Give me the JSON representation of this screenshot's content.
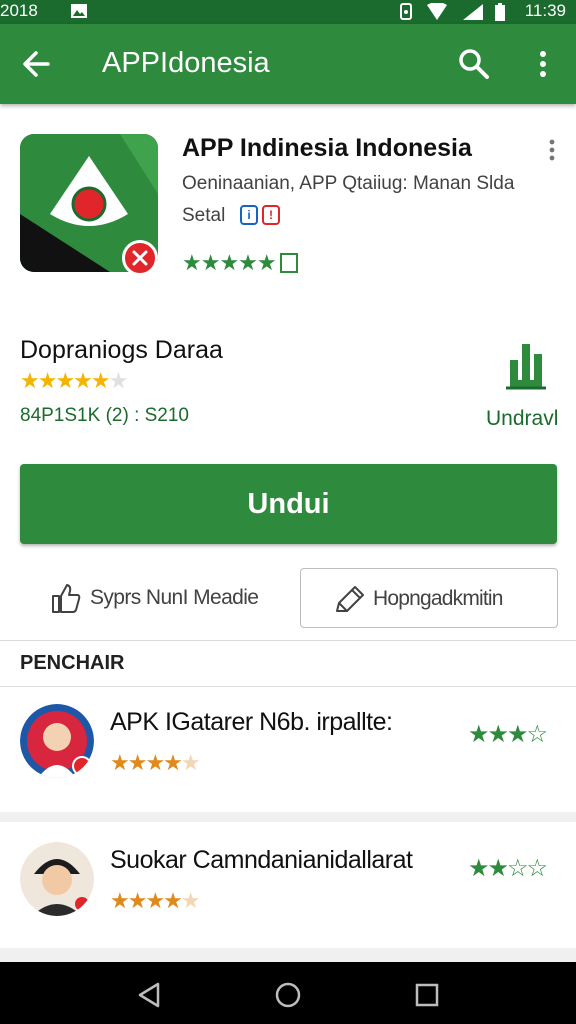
{
  "status_bar": {
    "time_left": "2018",
    "time_right": "11:39"
  },
  "app_bar": {
    "title": "APPIdonesia",
    "icons": [
      "back-arrow-icon",
      "search-icon",
      "more-vert-icon"
    ]
  },
  "app": {
    "name": "APP Indinesia Indonesia",
    "developer": "Oeninaanian, APP Qtaiiug: Manan Slda",
    "category": "Setal",
    "category_badges": [
      "info",
      "warning"
    ],
    "rating_stars": "★★★★★",
    "colors": {
      "accent": "#2e8b3e",
      "badge": "#e0262b"
    }
  },
  "download": {
    "title": "Dopraniogs Daraa",
    "stars_filled": "★★★★★",
    "stars_empty": "★",
    "meta": "84P1S1K (2) : S210",
    "link_label": "Undravl"
  },
  "main_button": {
    "label": "Undui"
  },
  "actions": {
    "like_label": "Syprs NunI Meadie",
    "edit_label": "Hopngadkmitin"
  },
  "section": {
    "heading": "PENCHAIR"
  },
  "reviews": [
    {
      "title": "APK IGatarer N6b. irpallte:",
      "stars_filled": "★★★★",
      "stars_empty": "★",
      "green_stars": "★★★☆"
    },
    {
      "title": "Suokar Camndanianidallarat",
      "stars_filled": "★★★★",
      "stars_empty": "★",
      "green_stars": "★★☆☆"
    }
  ],
  "nav": {
    "icons": [
      "back-triangle-icon",
      "home-circle-icon",
      "recents-square-icon"
    ]
  }
}
